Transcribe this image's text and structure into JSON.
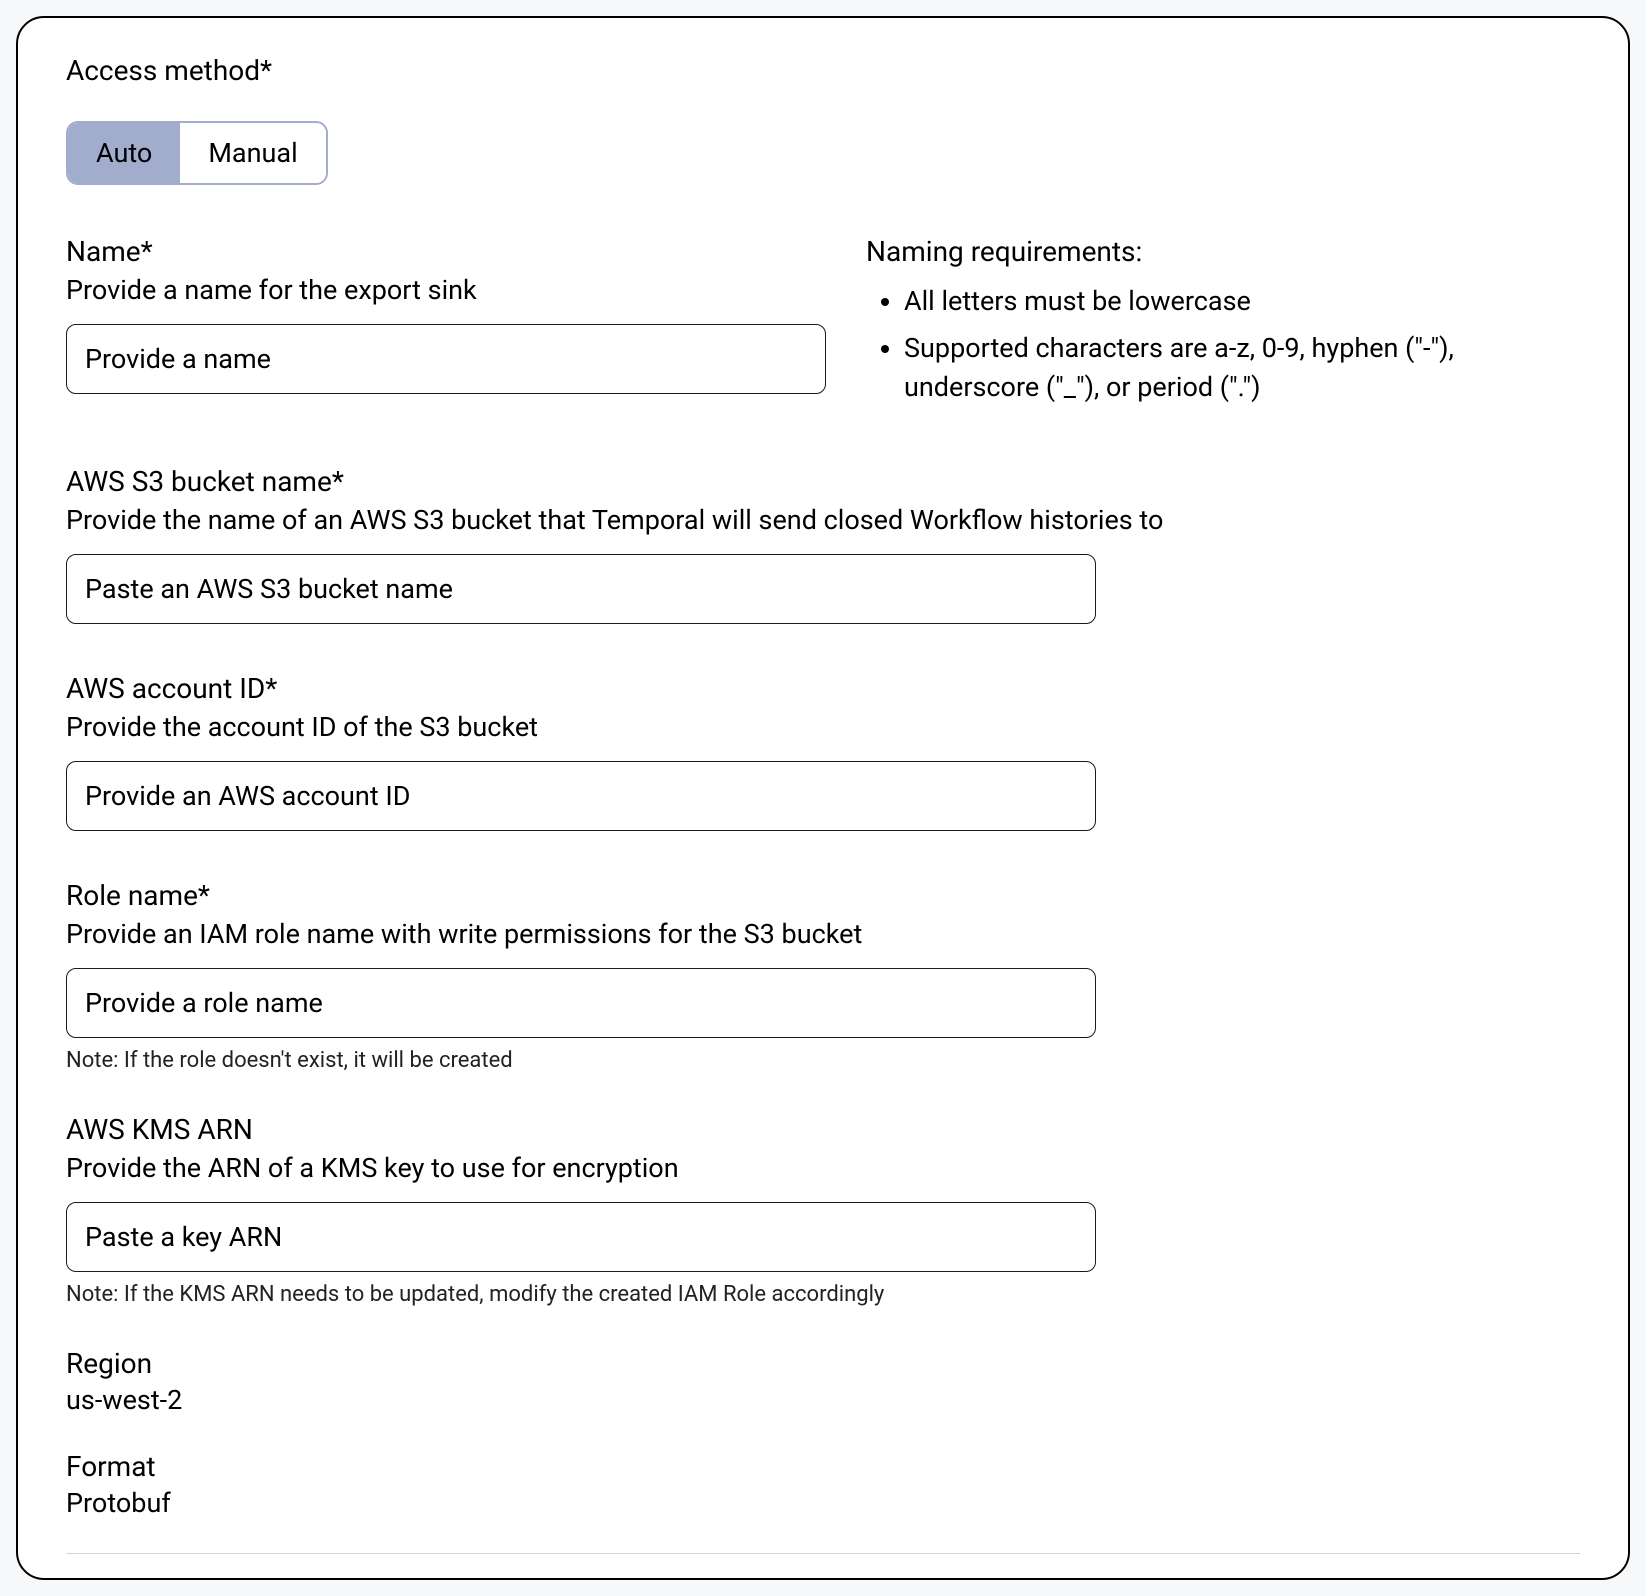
{
  "access_method": {
    "label": "Access method*",
    "auto_label": "Auto",
    "manual_label": "Manual"
  },
  "name_field": {
    "label": "Name*",
    "desc": "Provide a name for the export sink",
    "placeholder": "Provide a name"
  },
  "naming_req": {
    "title": "Naming requirements:",
    "items": [
      "All letters must be lowercase",
      "Supported characters are a-z, 0-9, hyphen (\"-\"), underscore (\"_\"), or period (\".\")"
    ]
  },
  "bucket_field": {
    "label": "AWS S3 bucket name*",
    "desc": "Provide the name of an AWS S3 bucket that Temporal will send closed Workflow histories to",
    "placeholder": "Paste an AWS S3 bucket name"
  },
  "account_field": {
    "label": "AWS account ID*",
    "desc": "Provide the account ID of the S3 bucket",
    "placeholder": "Provide an AWS account ID"
  },
  "role_field": {
    "label": "Role name*",
    "desc": "Provide an IAM role name with write permissions for the S3 bucket",
    "placeholder": "Provide a role name",
    "note": "Note: If the role doesn't exist, it will be created"
  },
  "kms_field": {
    "label": "AWS KMS ARN",
    "desc": "Provide the ARN of a KMS key to use for encryption",
    "placeholder": "Paste a key ARN",
    "note": "Note: If the KMS ARN needs to be updated, modify the created IAM Role accordingly"
  },
  "region": {
    "label": "Region",
    "value": "us-west-2"
  },
  "format": {
    "label": "Format",
    "value": "Protobuf"
  }
}
